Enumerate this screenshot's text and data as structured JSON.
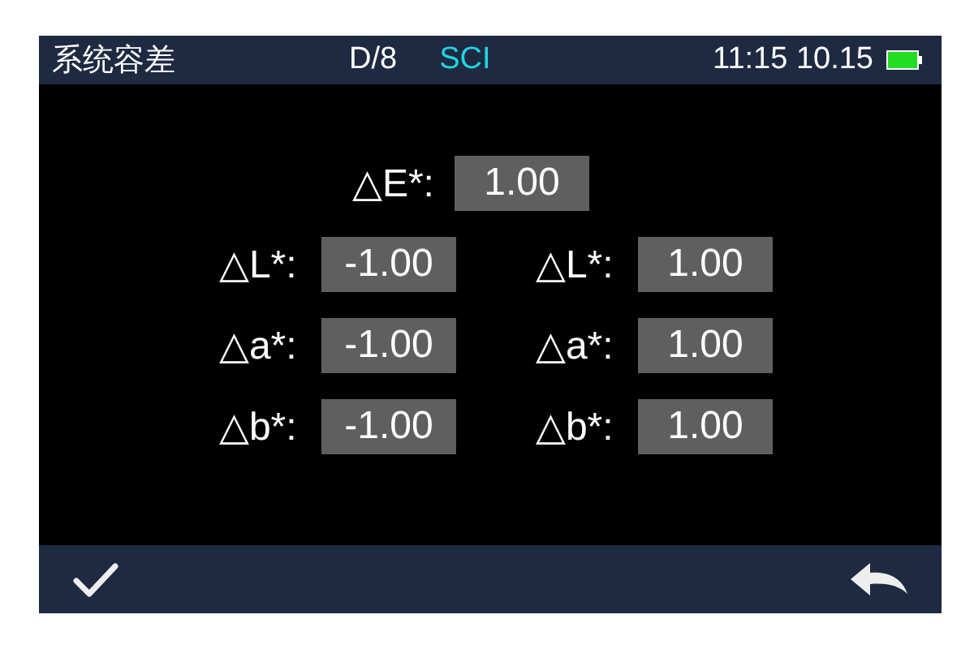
{
  "status_bar": {
    "title": "系统容差",
    "geometry": "D/8",
    "mode": "SCI",
    "time": "11:15 10.15"
  },
  "total": {
    "label": "△E*:",
    "value": "1.00"
  },
  "rows": [
    {
      "left": {
        "label": "△L*:",
        "value": "-1.00"
      },
      "right": {
        "label": "△L*:",
        "value": "1.00"
      }
    },
    {
      "left": {
        "label": "△a*:",
        "value": "-1.00"
      },
      "right": {
        "label": "△a*:",
        "value": "1.00"
      }
    },
    {
      "left": {
        "label": "△b*:",
        "value": "-1.00"
      },
      "right": {
        "label": "△b*:",
        "value": "1.00"
      }
    }
  ],
  "footer": {
    "buttons": [
      {
        "kind": "confirm"
      },
      {
        "kind": "back"
      }
    ]
  }
}
